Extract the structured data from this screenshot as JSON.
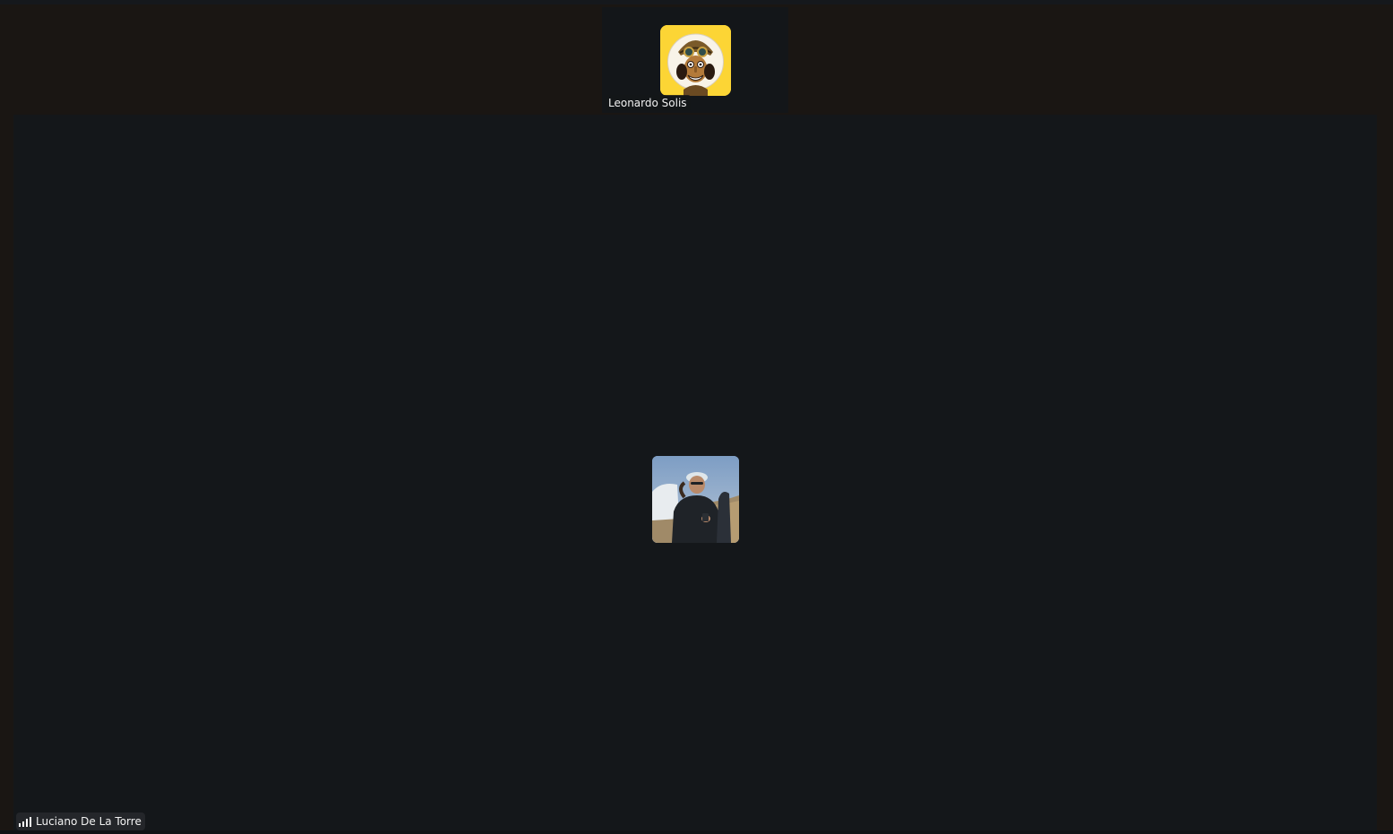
{
  "participants": {
    "thumbnail": {
      "name": "Leonardo Solis",
      "avatar_icon": "cartoon-character-avatar",
      "avatar_bg": "#fcd535"
    },
    "active_speaker": {
      "name": "Luciano De La Torre",
      "avatar_icon": "photo-avatar",
      "connection_icon": "signal-strength-icon"
    }
  },
  "colors": {
    "app_bg": "#1a1613",
    "video_bg": "#14171a",
    "thumbnail_bg": "#131619",
    "label_text": "#f2f2f2"
  }
}
